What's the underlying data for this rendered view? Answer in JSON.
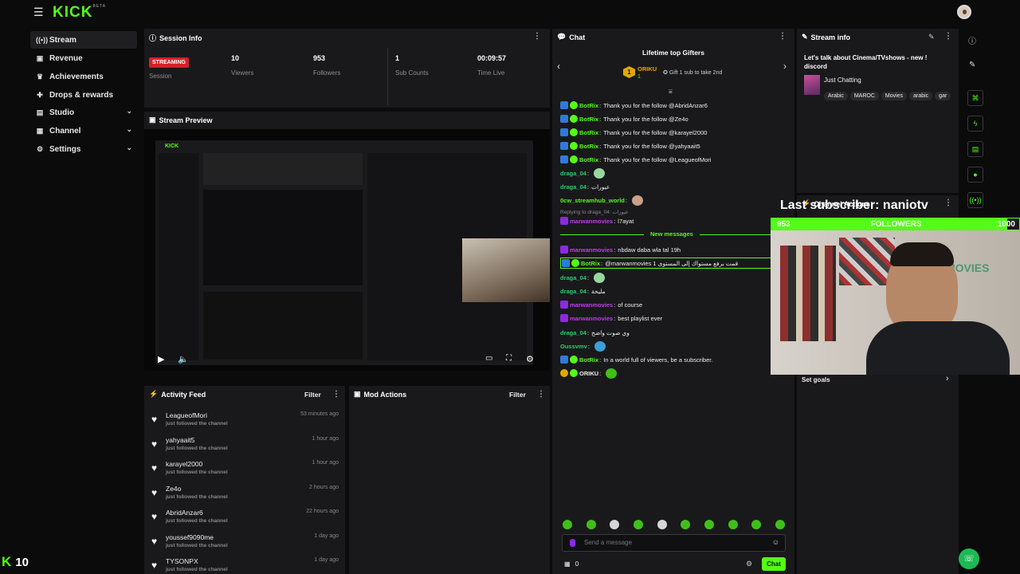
{
  "app": {
    "logo": "KICK",
    "logo_sup": "BETA"
  },
  "sidebar": {
    "items": [
      {
        "label": "Stream",
        "icon": "radio-icon",
        "active": true
      },
      {
        "label": "Revenue",
        "icon": "revenue-icon"
      },
      {
        "label": "Achievements",
        "icon": "trophy-icon"
      },
      {
        "label": "Drops & rewards",
        "icon": "gift-icon"
      },
      {
        "label": "Studio",
        "icon": "studio-icon",
        "chevron": true
      },
      {
        "label": "Channel",
        "icon": "channel-icon",
        "chevron": true
      },
      {
        "label": "Settings",
        "icon": "gear-icon",
        "chevron": true
      }
    ]
  },
  "session": {
    "title": "Session Info",
    "status": "STREAMING",
    "status_label": "Session",
    "stats": [
      {
        "value": "10",
        "label": "Viewers"
      },
      {
        "value": "953",
        "label": "Followers"
      },
      {
        "value": "1",
        "label": "Sub Counts"
      },
      {
        "value": "00:09:57",
        "label": "Time Live"
      }
    ]
  },
  "preview": {
    "title": "Stream Preview"
  },
  "activity": {
    "title": "Activity Feed",
    "filter": "Filter",
    "sub": "just followed the channel",
    "rows": [
      {
        "name": "LeagueofMori",
        "time": "53 minutes ago"
      },
      {
        "name": "yahyaait5",
        "time": "1 hour ago"
      },
      {
        "name": "karayel2000",
        "time": "1 hour ago"
      },
      {
        "name": "Ze4o",
        "time": "2 hours ago"
      },
      {
        "name": "AbridAnzar6",
        "time": "22 hours ago"
      },
      {
        "name": "youssef9090me",
        "time": "1 day ago"
      },
      {
        "name": "TYSONPX",
        "time": "1 day ago"
      }
    ]
  },
  "mod": {
    "title": "Mod Actions",
    "filter": "Filter"
  },
  "chat": {
    "title": "Chat",
    "gifters_title": "Lifetime top Gifters",
    "top_gifter": "ORIKU",
    "top_gifter_count": "1",
    "gift_hint": "Gift 1 sub to take 2nd",
    "new_messages": "New messages",
    "replying": "Replying to draga_04: عيورات",
    "placeholder": "Send a message",
    "count": "0",
    "send": "Chat",
    "messages": [
      {
        "user": "BotRix",
        "color": "#53fc18",
        "badges": [
          "b-blue",
          "b-green"
        ],
        "text": "Thank you for the follow @AbridAnzar6"
      },
      {
        "user": "BotRix",
        "color": "#53fc18",
        "badges": [
          "b-blue",
          "b-green"
        ],
        "text": "Thank you for the follow @Ze4o"
      },
      {
        "user": "BotRix",
        "color": "#53fc18",
        "badges": [
          "b-blue",
          "b-green"
        ],
        "text": "Thank you for the follow @karayel2000"
      },
      {
        "user": "BotRix",
        "color": "#53fc18",
        "badges": [
          "b-blue",
          "b-green"
        ],
        "text": "Thank you for the follow @yahyaait5"
      },
      {
        "user": "BotRix",
        "color": "#53fc18",
        "badges": [
          "b-blue",
          "b-green"
        ],
        "text": "Thank you for the follow @LeagueofMori"
      },
      {
        "user": "draga_04",
        "color": "#2ecc71",
        "badges": [],
        "text": "",
        "emote": true
      },
      {
        "user": "draga_04",
        "color": "#2ecc71",
        "badges": [],
        "text": "عيورات"
      },
      {
        "user": "0cw_streamhub_world",
        "color": "#53fc18",
        "badges": [],
        "text": "",
        "emote": true
      },
      {
        "user": "marwanmovies",
        "color": "#c23aef",
        "badges": [
          "b-purple"
        ],
        "text": "l7ayat"
      },
      {
        "user": "marwanmovies",
        "color": "#c23aef",
        "badges": [
          "b-purple"
        ],
        "text": "nbdaw daba wla tal 19h"
      },
      {
        "user": "BotRix",
        "color": "#53fc18",
        "badges": [
          "b-blue",
          "b-green"
        ],
        "text": "@marwanmovies قمت برفع مستواك إلى المستوى 1"
      },
      {
        "user": "draga_04",
        "color": "#2ecc71",
        "badges": [],
        "text": "",
        "emote": true
      },
      {
        "user": "draga_04",
        "color": "#2ecc71",
        "badges": [],
        "text": "مليحة"
      },
      {
        "user": "marwanmovies",
        "color": "#c23aef",
        "badges": [
          "b-purple"
        ],
        "text": "of course"
      },
      {
        "user": "marwanmovies",
        "color": "#c23aef",
        "badges": [
          "b-purple"
        ],
        "text": "best playlist ever"
      },
      {
        "user": "draga_04",
        "color": "#2ecc71",
        "badges": [],
        "text": "وي صوت واضح"
      },
      {
        "user": "Oussvmv",
        "color": "#2ecc71",
        "badges": [],
        "text": "",
        "emote": true
      },
      {
        "user": "BotRix",
        "color": "#53fc18",
        "badges": [
          "b-blue",
          "b-green"
        ],
        "text": "In a world full of viewers, be a subscriber."
      },
      {
        "user": "ORIKU",
        "color": "#eeeeee",
        "badges": [
          "b-gold",
          "b-green"
        ],
        "text": "",
        "emote": true
      }
    ]
  },
  "stream_info": {
    "title": "Stream info",
    "stream_title": "Let's talk about Cinema/TVshows - new ! discord",
    "category": "Just Chatting",
    "tags": [
      "Arabic",
      "MAROC",
      "Movies",
      "arabic",
      "gar"
    ]
  },
  "channel_actions": {
    "title": "Channel Actions"
  },
  "goals": {
    "label": "Set goals"
  },
  "overlay": {
    "last_sub": "Last subscriber: naniotv",
    "goal_current": "953",
    "goal_label": "FOLLOWERS",
    "goal_target": "1000",
    "goal_progress": 0.953,
    "webcam_sign": "MOVIES"
  },
  "viewer_count": "10",
  "colors": {
    "accent": "#53fc18",
    "live": "#d4202b",
    "panel": "#19191b",
    "bg": "#0b0b0c"
  }
}
